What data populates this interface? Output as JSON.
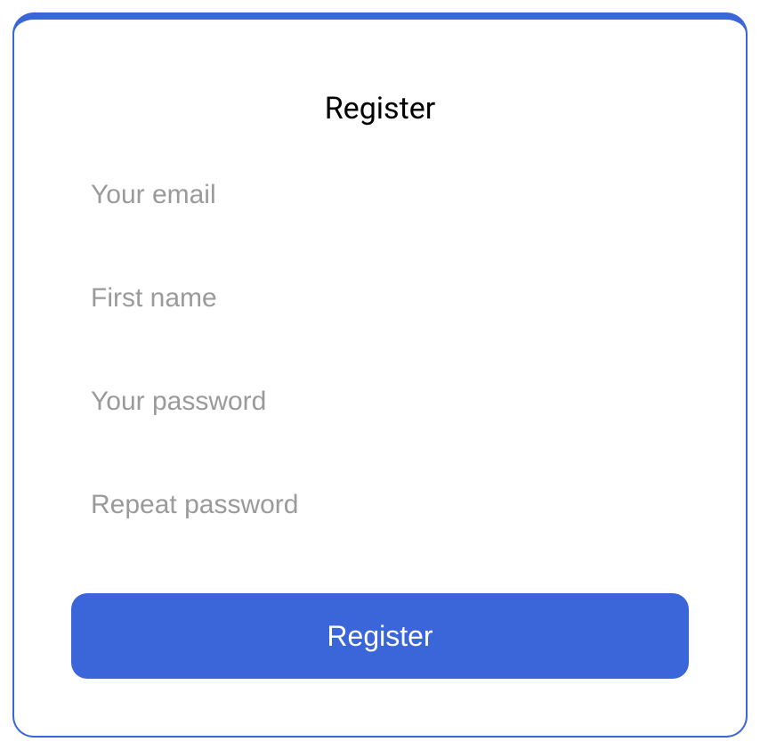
{
  "form": {
    "title": "Register",
    "fields": {
      "email": {
        "placeholder": "Your email",
        "value": ""
      },
      "first_name": {
        "placeholder": "First name",
        "value": ""
      },
      "password": {
        "placeholder": "Your password",
        "value": ""
      },
      "repeat_password": {
        "placeholder": "Repeat password",
        "value": ""
      }
    },
    "submit_label": "Register"
  },
  "colors": {
    "accent": "#3b66d9",
    "placeholder": "#9a9a9a"
  }
}
